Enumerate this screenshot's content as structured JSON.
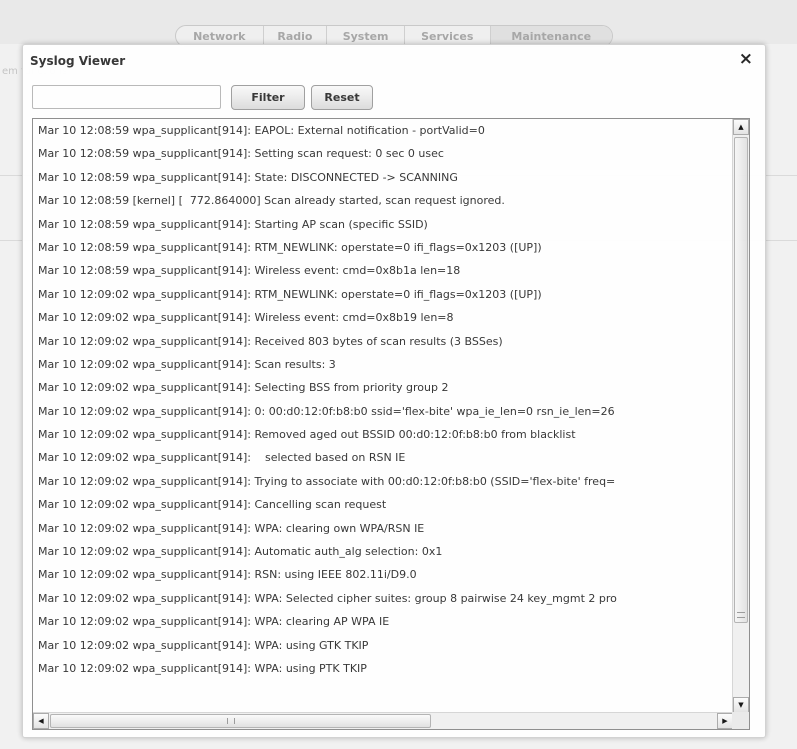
{
  "background": {
    "tabs": [
      {
        "label": "Network"
      },
      {
        "label": "Radio"
      },
      {
        "label": "System"
      },
      {
        "label": "Services"
      },
      {
        "label": "Maintenance"
      }
    ],
    "section_fragment": "em functions"
  },
  "dialog": {
    "title": "Syslog Viewer",
    "close_glyph": "×"
  },
  "filter": {
    "value": "",
    "filter_label": "Filter",
    "reset_label": "Reset"
  },
  "log_lines": [
    "Mar 10 12:08:59 wpa_supplicant[914]: EAPOL: External notification - portValid=0",
    "Mar 10 12:08:59 wpa_supplicant[914]: Setting scan request: 0 sec 0 usec",
    "Mar 10 12:08:59 wpa_supplicant[914]: State: DISCONNECTED -> SCANNING",
    "Mar 10 12:08:59 [kernel] [  772.864000] Scan already started, scan request ignored.",
    "Mar 10 12:08:59 wpa_supplicant[914]: Starting AP scan (specific SSID)",
    "Mar 10 12:08:59 wpa_supplicant[914]: RTM_NEWLINK: operstate=0 ifi_flags=0x1203 ([UP])",
    "Mar 10 12:08:59 wpa_supplicant[914]: Wireless event: cmd=0x8b1a len=18",
    "Mar 10 12:09:02 wpa_supplicant[914]: RTM_NEWLINK: operstate=0 ifi_flags=0x1203 ([UP])",
    "Mar 10 12:09:02 wpa_supplicant[914]: Wireless event: cmd=0x8b19 len=8",
    "Mar 10 12:09:02 wpa_supplicant[914]: Received 803 bytes of scan results (3 BSSes)",
    "Mar 10 12:09:02 wpa_supplicant[914]: Scan results: 3",
    "Mar 10 12:09:02 wpa_supplicant[914]: Selecting BSS from priority group 2",
    "Mar 10 12:09:02 wpa_supplicant[914]: 0: 00:d0:12:0f:b8:b0 ssid='flex-bite' wpa_ie_len=0 rsn_ie_len=26",
    "Mar 10 12:09:02 wpa_supplicant[914]: Removed aged out BSSID 00:d0:12:0f:b8:b0 from blacklist",
    "Mar 10 12:09:02 wpa_supplicant[914]:    selected based on RSN IE",
    "Mar 10 12:09:02 wpa_supplicant[914]: Trying to associate with 00:d0:12:0f:b8:b0 (SSID='flex-bite' freq=",
    "Mar 10 12:09:02 wpa_supplicant[914]: Cancelling scan request",
    "Mar 10 12:09:02 wpa_supplicant[914]: WPA: clearing own WPA/RSN IE",
    "Mar 10 12:09:02 wpa_supplicant[914]: Automatic auth_alg selection: 0x1",
    "Mar 10 12:09:02 wpa_supplicant[914]: RSN: using IEEE 802.11i/D9.0",
    "Mar 10 12:09:02 wpa_supplicant[914]: WPA: Selected cipher suites: group 8 pairwise 24 key_mgmt 2 pro",
    "Mar 10 12:09:02 wpa_supplicant[914]: WPA: clearing AP WPA IE",
    "Mar 10 12:09:02 wpa_supplicant[914]: WPA: using GTK TKIP",
    "Mar 10 12:09:02 wpa_supplicant[914]: WPA: using PTK TKIP"
  ],
  "scroll": {
    "up_glyph": "▲",
    "down_glyph": "▼",
    "left_glyph": "◀",
    "right_glyph": "▶"
  },
  "colors": {
    "text": "#333333",
    "border": "#8c8c8c"
  }
}
